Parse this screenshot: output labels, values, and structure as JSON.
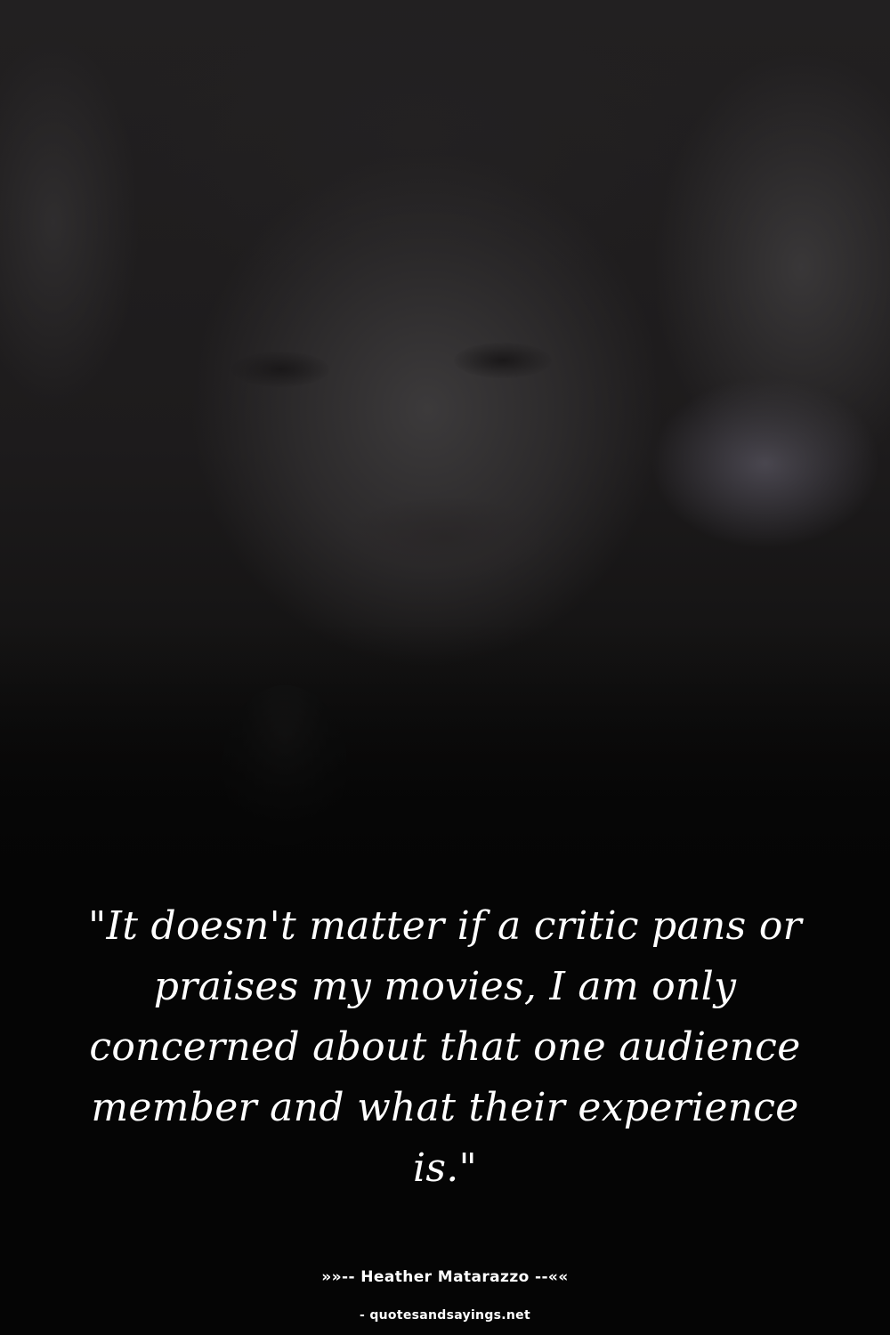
{
  "quote": {
    "text": "\"It doesn't matter if a critic pans or praises my movies, I am only concerned about that one audience member and what their experience is.\""
  },
  "author": {
    "line": "»»-- Heather Matarazzo --««"
  },
  "source": {
    "text": "- quotesandsayings.net"
  },
  "colors": {
    "background": "#050505",
    "text": "#ffffff"
  }
}
